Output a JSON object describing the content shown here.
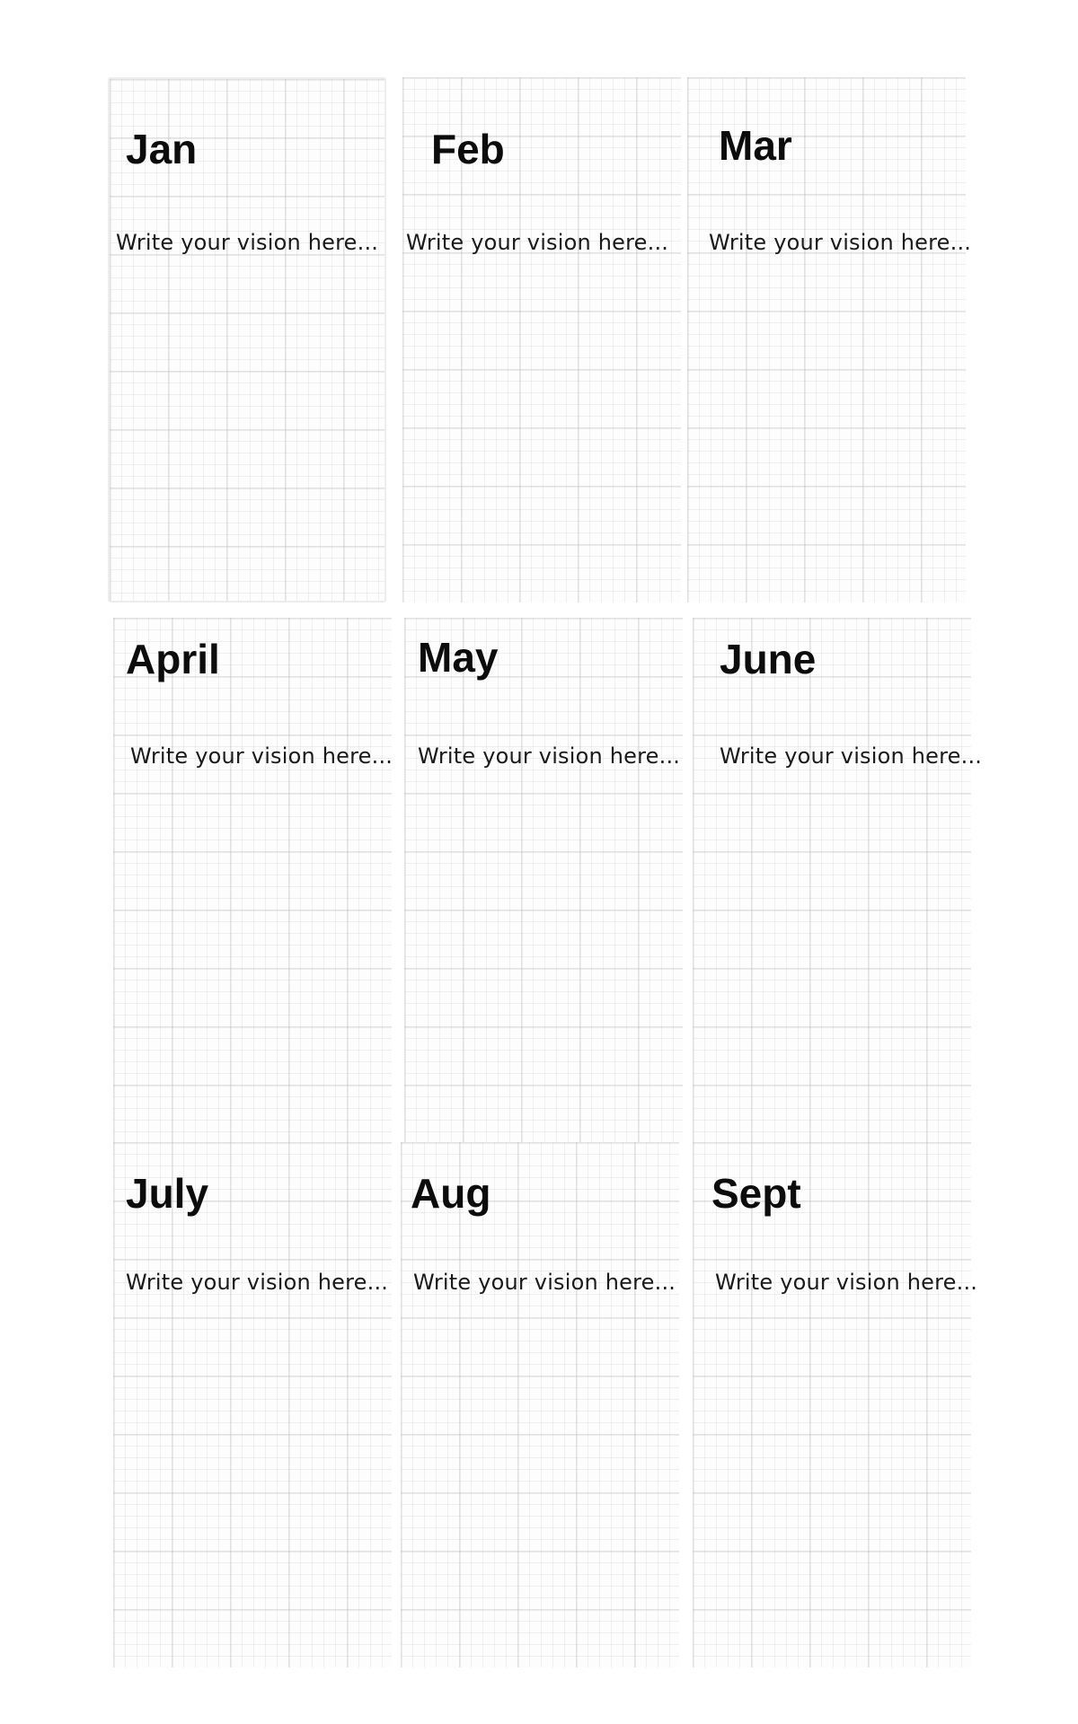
{
  "document": {
    "placeholder": "Write your vision here...",
    "months": [
      {
        "name": "Jan",
        "placeholder": "Write your vision here..."
      },
      {
        "name": "Feb",
        "placeholder": "Write your vision here..."
      },
      {
        "name": "Mar",
        "placeholder": "Write your vision here..."
      },
      {
        "name": "April",
        "placeholder": "Write your vision here..."
      },
      {
        "name": "May",
        "placeholder": "Write your vision here..."
      },
      {
        "name": "June",
        "placeholder": "Write your vision here..."
      },
      {
        "name": "July",
        "placeholder": "Write your vision here..."
      },
      {
        "name": "Aug",
        "placeholder": "Write your vision here..."
      },
      {
        "name": "Sept",
        "placeholder": "Write your vision here..."
      }
    ]
  },
  "colors": {
    "background": "#ffffff",
    "grid_line": "#d8d8d8",
    "text": "#111111"
  }
}
